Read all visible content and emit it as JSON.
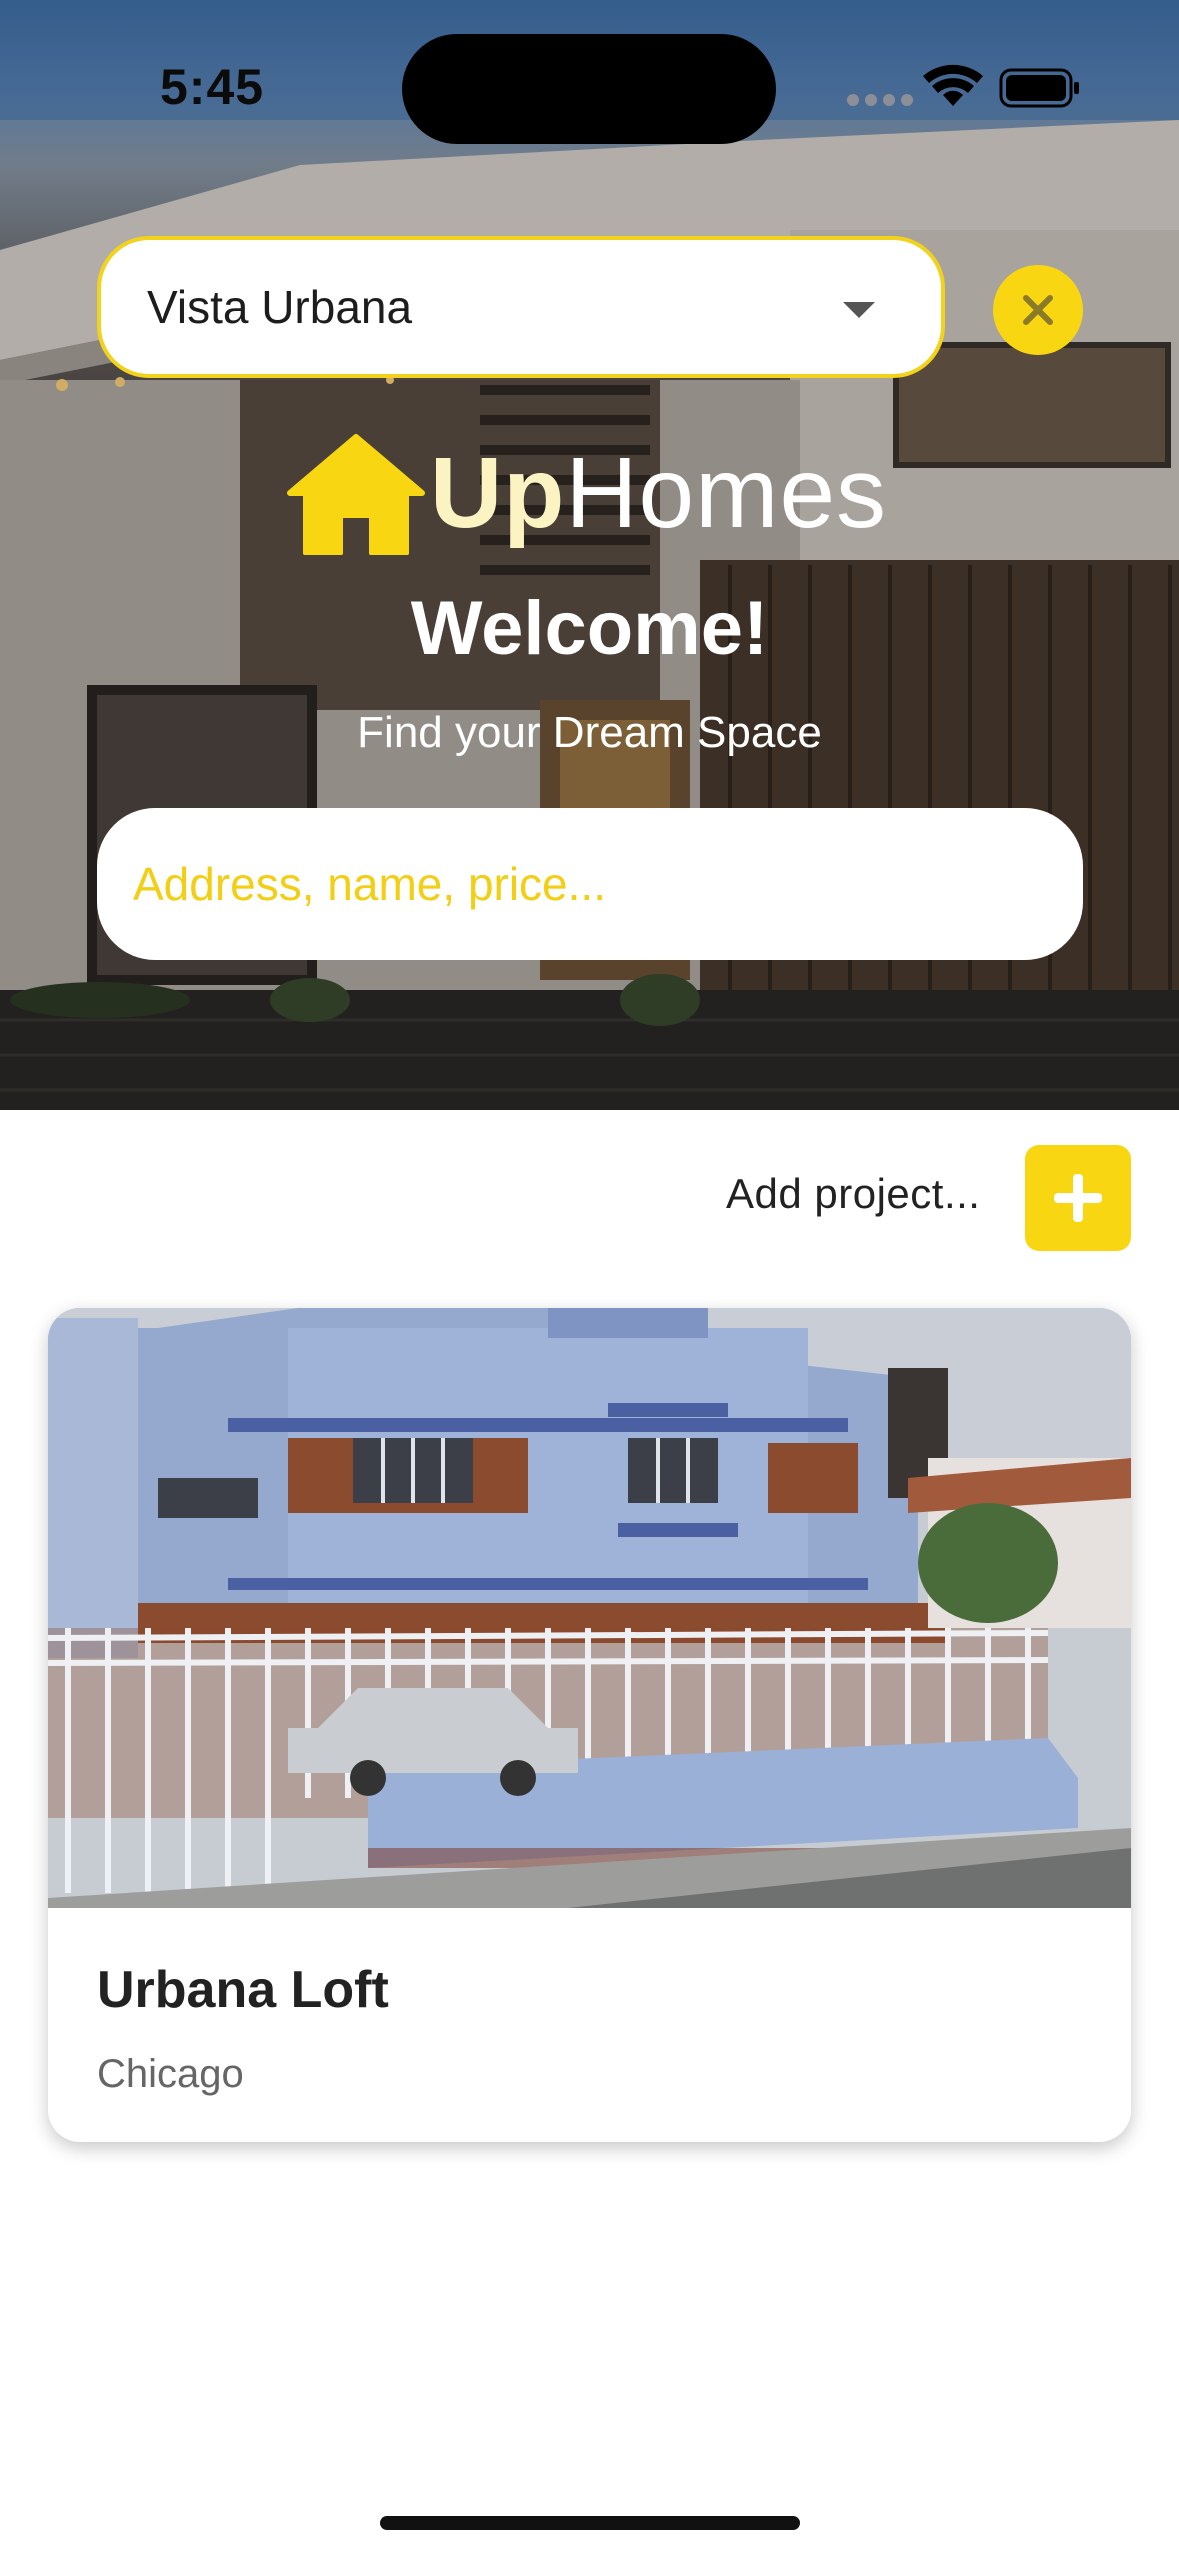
{
  "status_bar": {
    "time": "5:45",
    "icons": [
      "signal-dots-icon",
      "wifi-icon",
      "battery-icon"
    ]
  },
  "header": {
    "project_selector": {
      "selected_value": "Vista Urbana",
      "caret_icon": "caret-down-icon"
    },
    "clear_icon": "close-icon",
    "logo": {
      "icon": "house-icon",
      "bold_part": "Up",
      "light_part": "Homes"
    },
    "welcome": "Welcome!",
    "tagline": "Find your Dream Space",
    "search": {
      "placeholder": "Address, name, price...",
      "value": ""
    }
  },
  "actions": {
    "add_project_label": "Add project...",
    "add_icon": "plus-icon"
  },
  "projects": [
    {
      "title": "Urbana Loft",
      "location": "Chicago"
    }
  ],
  "colors": {
    "accent": "#F8D712",
    "logo_up": "#FBF3C2",
    "card_title": "#222222",
    "card_subtitle": "#666666"
  }
}
